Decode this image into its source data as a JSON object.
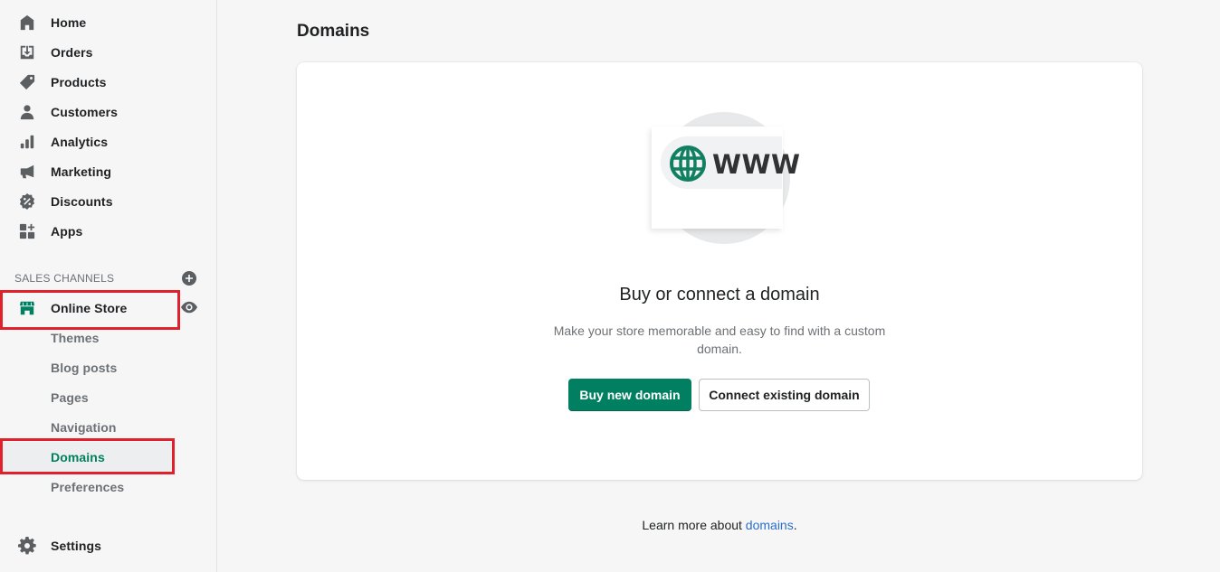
{
  "sidebar": {
    "items": [
      {
        "label": "Home",
        "icon": "home-icon"
      },
      {
        "label": "Orders",
        "icon": "orders-icon"
      },
      {
        "label": "Products",
        "icon": "tag-icon"
      },
      {
        "label": "Customers",
        "icon": "person-icon"
      },
      {
        "label": "Analytics",
        "icon": "bar-chart-icon"
      },
      {
        "label": "Marketing",
        "icon": "megaphone-icon"
      },
      {
        "label": "Discounts",
        "icon": "discount-icon"
      },
      {
        "label": "Apps",
        "icon": "apps-icon"
      }
    ],
    "sales_channels_title": "SALES CHANNELS",
    "online_store": {
      "label": "Online Store",
      "icon": "store-icon"
    },
    "online_store_sub": [
      {
        "label": "Themes"
      },
      {
        "label": "Blog posts"
      },
      {
        "label": "Pages"
      },
      {
        "label": "Navigation"
      },
      {
        "label": "Domains",
        "active": true
      },
      {
        "label": "Preferences"
      }
    ],
    "settings": {
      "label": "Settings",
      "icon": "gear-icon"
    }
  },
  "main": {
    "page_title": "Domains",
    "card": {
      "illustration_text": "WWW",
      "heading": "Buy or connect a domain",
      "description": "Make your store memorable and easy to find with a custom domain.",
      "primary_button": "Buy new domain",
      "secondary_button": "Connect existing domain"
    },
    "footer": {
      "prefix": "Learn more about ",
      "link": "domains",
      "suffix": "."
    }
  },
  "colors": {
    "accent": "#008060",
    "link": "#2c6ecb",
    "highlight": "#e0202a"
  }
}
